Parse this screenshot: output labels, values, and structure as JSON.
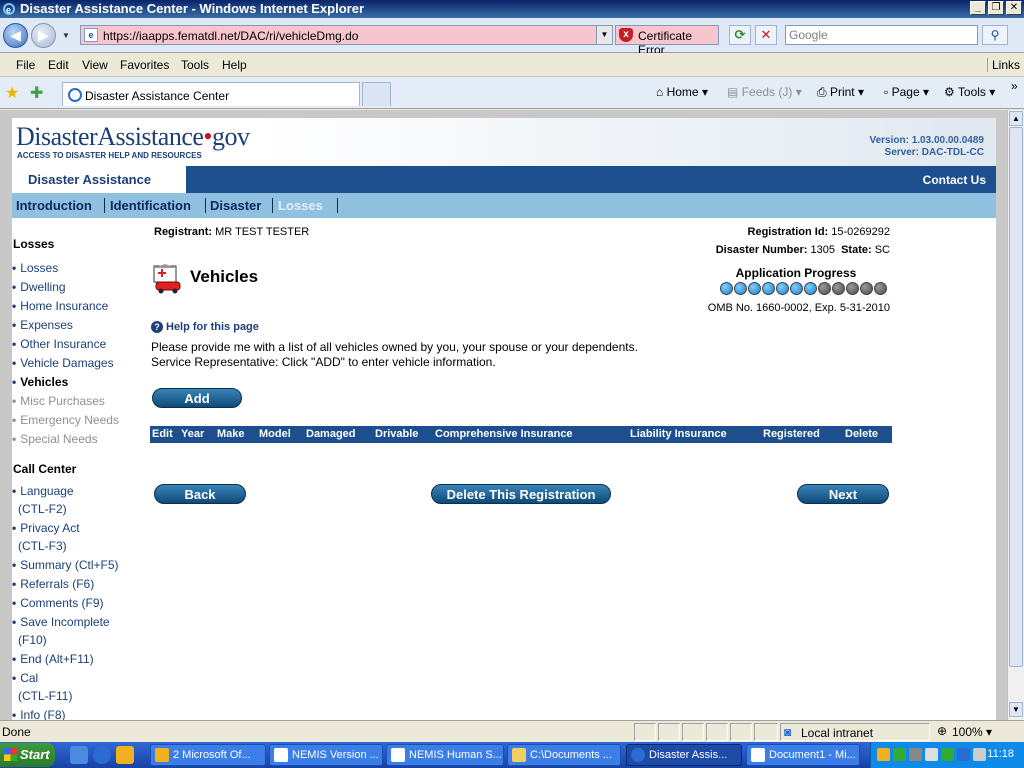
{
  "window": {
    "title": "Disaster Assistance Center - Windows Internet Explorer"
  },
  "address": {
    "url": "https://iaapps.fematdl.net/DAC/ri/vehicleDmg.do",
    "cert_error": "Certificate Error",
    "search_placeholder": "Google"
  },
  "menu": {
    "file": "File",
    "edit": "Edit",
    "view": "View",
    "favorites": "Favorites",
    "tools": "Tools",
    "help": "Help",
    "links": "Links"
  },
  "browser_tab": {
    "title": "Disaster Assistance Center"
  },
  "command_bar": {
    "home": "Home",
    "feeds": "Feeds (J)",
    "print": "Print",
    "page": "Page",
    "tools": "Tools"
  },
  "site": {
    "logo_main": "DisasterAssistance",
    "logo_dot": "•",
    "logo_gov": "gov",
    "logo_sub": "ACCESS TO DISASTER HELP AND RESOURCES",
    "version": "Version: 1.03.00.00.0489",
    "server": "Server: DAC-TDL-CC",
    "section_title": "Disaster Assistance",
    "contact": "Contact Us",
    "tabs": [
      "Introduction",
      "Identification",
      "Disaster",
      "Losses"
    ]
  },
  "sidebar": {
    "losses_heading": "Losses",
    "losses_items": [
      "Losses",
      "Dwelling",
      "Home Insurance",
      "Expenses",
      "Other Insurance",
      "Vehicle Damages",
      "Vehicles",
      "Misc Purchases",
      "Emergency Needs",
      "Special Needs"
    ],
    "call_heading": "Call Center",
    "call_items": [
      {
        "line1": "Language",
        "line2": "(CTL-F2)"
      },
      {
        "line1": "Privacy Act",
        "line2": "(CTL-F3)"
      },
      {
        "line1": "Summary (Ctl+F5)",
        "line2": ""
      },
      {
        "line1": "Referrals (F6)",
        "line2": ""
      },
      {
        "line1": "Comments (F9)",
        "line2": ""
      },
      {
        "line1": "Save Incomplete",
        "line2": "(F10)"
      },
      {
        "line1": "End (Alt+F11)",
        "line2": ""
      },
      {
        "line1": "Cal",
        "line2": "(CTL-F11)"
      },
      {
        "line1": "Info (F8)",
        "line2": ""
      }
    ]
  },
  "main": {
    "registrant_label": "Registrant:",
    "registrant_value": "MR TEST TESTER",
    "regid_label": "Registration Id:",
    "regid_value": "15-0269292",
    "disaster_label": "Disaster Number:",
    "disaster_value": "1305",
    "state_label": "State:",
    "state_value": "SC",
    "page_title": "Vehicles",
    "progress_title": "Application Progress",
    "progress_steps_done": 7,
    "progress_steps_total": 12,
    "omb": "OMB No. 1660-0002, Exp. 5-31-2010",
    "help": "Help for this page",
    "instruction1": "Please provide me with a list of all vehicles owned by you, your spouse or your dependents.",
    "instruction2": "Service Representative: Click \"ADD\" to enter vehicle information.",
    "add": "Add",
    "columns": [
      "Edit",
      "Year",
      "Make",
      "Model",
      "Damaged",
      "Drivable",
      "Comprehensive Insurance",
      "Liability Insurance",
      "Registered",
      "Delete"
    ],
    "back": "Back",
    "delete_reg": "Delete This Registration",
    "next": "Next"
  },
  "status": {
    "text": "Done",
    "zone": "Local intranet",
    "zoom": "100%"
  },
  "taskbar": {
    "start": "Start",
    "tasks": [
      "2 Microsoft Of...",
      "NEMIS Version ...",
      "NEMIS Human S...",
      "C:\\Documents ...",
      "Disaster Assis...",
      "Document1 - Mi..."
    ],
    "clock": "11:18"
  },
  "colors": {
    "navy": "#1d4f8f",
    "light_blue": "#8fc0e0",
    "brand": "#1c3f7a"
  }
}
